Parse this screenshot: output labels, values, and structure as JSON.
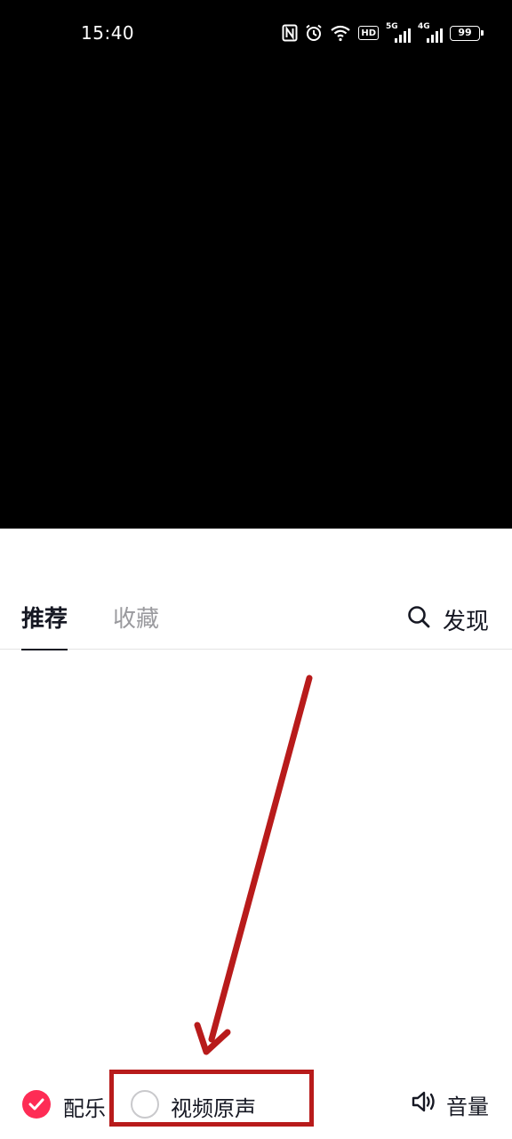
{
  "status_bar": {
    "time": "15:40",
    "icons": [
      "nfc-icon",
      "alarm-icon",
      "wifi-icon",
      "hd-voice-icon",
      "signal-5g-icon",
      "signal-4g-icon",
      "battery-icon"
    ],
    "hd_label": "HD",
    "net1_label": "5G",
    "net2_label": "4G",
    "battery_level": "99"
  },
  "tabs": {
    "recommend_label": "推荐",
    "favorites_label": "收藏",
    "discover_label": "发现",
    "active_tab": "推荐"
  },
  "bottom_controls": {
    "music_label": "配乐",
    "music_checked": true,
    "original_sound_label": "视频原声",
    "original_sound_checked": false,
    "volume_label": "音量"
  },
  "colors": {
    "accent": "#fe2c55",
    "annotation": "#b81b1b",
    "text_primary": "#161823",
    "text_secondary": "#9a9a9e"
  }
}
